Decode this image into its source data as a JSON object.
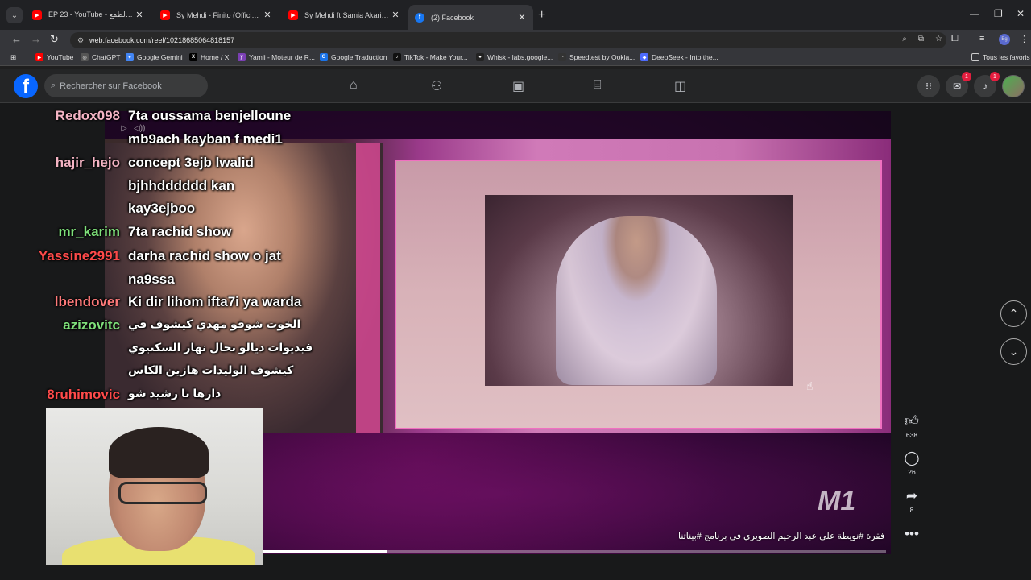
{
  "browser": {
    "tabs": [
      {
        "title": "EP 23 - YouTube - عش الطمع",
        "favicon": "youtube-icon",
        "active": false
      },
      {
        "title": "Sy Mehdi - Finito (Official Musi",
        "favicon": "youtube-icon",
        "active": false
      },
      {
        "title": "Sy Mehdi ft Samia Akariou - Nu",
        "favicon": "youtube-icon",
        "active": false
      },
      {
        "title": "(2) Facebook",
        "favicon": "facebook-icon",
        "active": true
      }
    ],
    "url": "web.facebook.com/reel/1021868506481815­7",
    "bookmarks": [
      {
        "label": "YouTube",
        "color": "#ff0000"
      },
      {
        "label": "ChatGPT",
        "color": "#444444"
      },
      {
        "label": "Google Gemini",
        "color": "#4285f4"
      },
      {
        "label": "Home / X",
        "color": "#000000"
      },
      {
        "label": "Yamli - Moteur de R...",
        "color": "#7b3fb4"
      },
      {
        "label": "Google Traduction",
        "color": "#1a73e8"
      },
      {
        "label": "TikTok - Make Your...",
        "color": "#111111"
      },
      {
        "label": "Whisk - labs.google...",
        "color": "#222222"
      },
      {
        "label": "Speedtest by Ookla...",
        "color": "#333333"
      },
      {
        "label": "DeepSeek - Into the...",
        "color": "#4d6bfe"
      }
    ],
    "all_bookmarks": "Tous les favoris"
  },
  "facebook": {
    "search_placeholder": "Rechercher sur Facebook",
    "messenger_badge": "1",
    "notifications_badge": "1"
  },
  "chat": [
    {
      "user": "Redox098",
      "color": "#f4b4c4",
      "lines": [
        "7ta oussama benjelloune",
        "mb9ach kayban f medi1"
      ]
    },
    {
      "user": "hajir_hejo",
      "color": "#f4b4c4",
      "lines": [
        "concept 3ejb lwalid",
        "bjhhdddddd kan",
        "kay3ejboo"
      ]
    },
    {
      "user": "mr_karim",
      "color": "#7ee07a",
      "lines": [
        "7ta rachid show"
      ]
    },
    {
      "user": "Yassine2991",
      "color": "#ff4a4a",
      "lines": [
        "darha rachid show o jat",
        "na9ssa"
      ]
    },
    {
      "user": "lbendover",
      "color": "#ff7a7a",
      "lines": [
        "Ki dir lihom ifta7i ya warda"
      ]
    },
    {
      "user": "azizovitc",
      "color": "#7ee07a",
      "lines": [
        "الخوت شوفو مهدي كيشوف في",
        "فيديوات ديالو بحال نهار السكتيوي",
        "كيشوف الوليدات هازين الكاس"
      ]
    },
    {
      "user": "8ruhimovic",
      "color": "#ff4a4a",
      "lines": [
        "دارها تا رشيد شو"
      ]
    }
  ],
  "reel": {
    "caption": "فقرة #نويطة على عبد الرحيم الصويري في برنامج #بيناتنا",
    "channel_logo": "M1",
    "progress": 0.2,
    "likes": "638",
    "comments": "26",
    "shares": "8"
  }
}
